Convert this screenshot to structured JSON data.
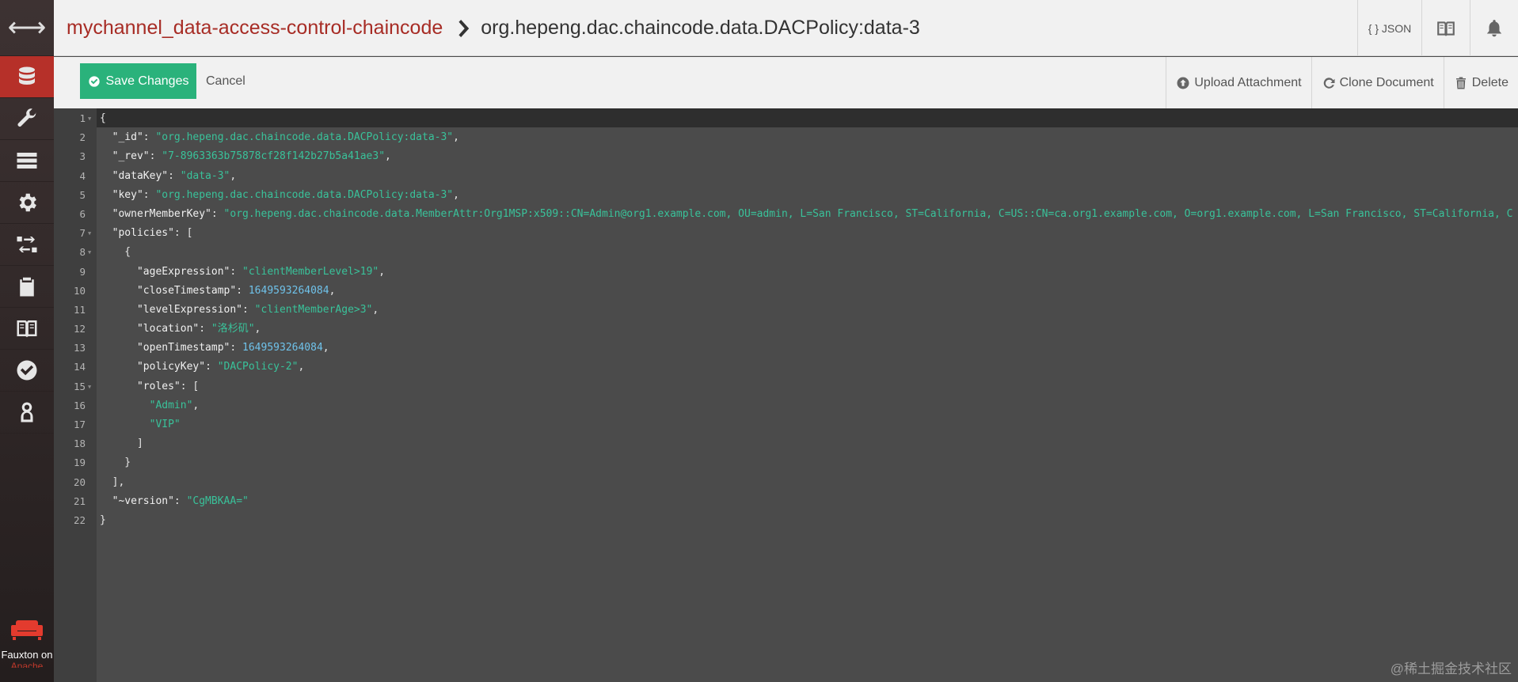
{
  "header": {
    "database": "mychannel_data-access-control-chaincode",
    "document": "org.hepeng.dac.chaincode.data.DACPolicy:data-3",
    "json_label": "{ } JSON"
  },
  "toolbar": {
    "save_label": "Save Changes",
    "cancel_label": "Cancel",
    "upload_label": "Upload Attachment",
    "clone_label": "Clone Document",
    "delete_label": "Delete"
  },
  "sidebar": {
    "items": [
      {
        "icon": "database-icon",
        "active": true
      },
      {
        "icon": "wrench-icon",
        "active": false
      },
      {
        "icon": "server-icon",
        "active": false
      },
      {
        "icon": "gear-icon",
        "active": false
      },
      {
        "icon": "replication-icon",
        "active": false
      },
      {
        "icon": "clipboard-icon",
        "active": false
      },
      {
        "icon": "book-icon",
        "active": false
      },
      {
        "icon": "check-circle-icon",
        "active": false
      },
      {
        "icon": "user-icon",
        "active": false
      }
    ],
    "footer_text": "Fauxton on",
    "footer_sub": "Apache"
  },
  "editor": {
    "lines": [
      [
        [
          "p",
          "{"
        ]
      ],
      [
        [
          "k",
          "  \"_id\""
        ],
        [
          "p",
          ": "
        ],
        [
          "s",
          "\"org.hepeng.dac.chaincode.data.DACPolicy:data-3\""
        ],
        [
          "p",
          ","
        ]
      ],
      [
        [
          "k",
          "  \"_rev\""
        ],
        [
          "p",
          ": "
        ],
        [
          "s",
          "\"7-8963363b75878cf28f142b27b5a41ae3\""
        ],
        [
          "p",
          ","
        ]
      ],
      [
        [
          "k",
          "  \"dataKey\""
        ],
        [
          "p",
          ": "
        ],
        [
          "s",
          "\"data-3\""
        ],
        [
          "p",
          ","
        ]
      ],
      [
        [
          "k",
          "  \"key\""
        ],
        [
          "p",
          ": "
        ],
        [
          "s",
          "\"org.hepeng.dac.chaincode.data.DACPolicy:data-3\""
        ],
        [
          "p",
          ","
        ]
      ],
      [
        [
          "k",
          "  \"ownerMemberKey\""
        ],
        [
          "p",
          ": "
        ],
        [
          "s",
          "\"org.hepeng.dac.chaincode.data.MemberAttr:Org1MSP:x509::CN=Admin@org1.example.com, OU=admin, L=San Francisco, ST=California, C=US::CN=ca.org1.example.com, O=org1.example.com, L=San Francisco, ST=California, C"
        ]
      ],
      [
        [
          "k",
          "  \"policies\""
        ],
        [
          "p",
          ": ["
        ]
      ],
      [
        [
          "p",
          "    {"
        ]
      ],
      [
        [
          "k",
          "      \"ageExpression\""
        ],
        [
          "p",
          ": "
        ],
        [
          "s",
          "\"clientMemberLevel>19\""
        ],
        [
          "p",
          ","
        ]
      ],
      [
        [
          "k",
          "      \"closeTimestamp\""
        ],
        [
          "p",
          ": "
        ],
        [
          "n",
          "1649593264084"
        ],
        [
          "p",
          ","
        ]
      ],
      [
        [
          "k",
          "      \"levelExpression\""
        ],
        [
          "p",
          ": "
        ],
        [
          "s",
          "\"clientMemberAge>3\""
        ],
        [
          "p",
          ","
        ]
      ],
      [
        [
          "k",
          "      \"location\""
        ],
        [
          "p",
          ": "
        ],
        [
          "s",
          "\"洛杉矶\""
        ],
        [
          "p",
          ","
        ]
      ],
      [
        [
          "k",
          "      \"openTimestamp\""
        ],
        [
          "p",
          ": "
        ],
        [
          "n",
          "1649593264084"
        ],
        [
          "p",
          ","
        ]
      ],
      [
        [
          "k",
          "      \"policyKey\""
        ],
        [
          "p",
          ": "
        ],
        [
          "s",
          "\"DACPolicy-2\""
        ],
        [
          "p",
          ","
        ]
      ],
      [
        [
          "k",
          "      \"roles\""
        ],
        [
          "p",
          ": ["
        ]
      ],
      [
        [
          "s",
          "        \"Admin\""
        ],
        [
          "p",
          ","
        ]
      ],
      [
        [
          "s",
          "        \"VIP\""
        ]
      ],
      [
        [
          "p",
          "      ]"
        ]
      ],
      [
        [
          "p",
          "    }"
        ]
      ],
      [
        [
          "p",
          "  ],"
        ]
      ],
      [
        [
          "k",
          "  \"~version\""
        ],
        [
          "p",
          ": "
        ],
        [
          "s",
          "\"CgMBKAA=\""
        ]
      ],
      [
        [
          "p",
          "}"
        ]
      ]
    ],
    "fold_lines": [
      1,
      7,
      8,
      15
    ]
  },
  "watermark": "@稀土掘金技术社区"
}
